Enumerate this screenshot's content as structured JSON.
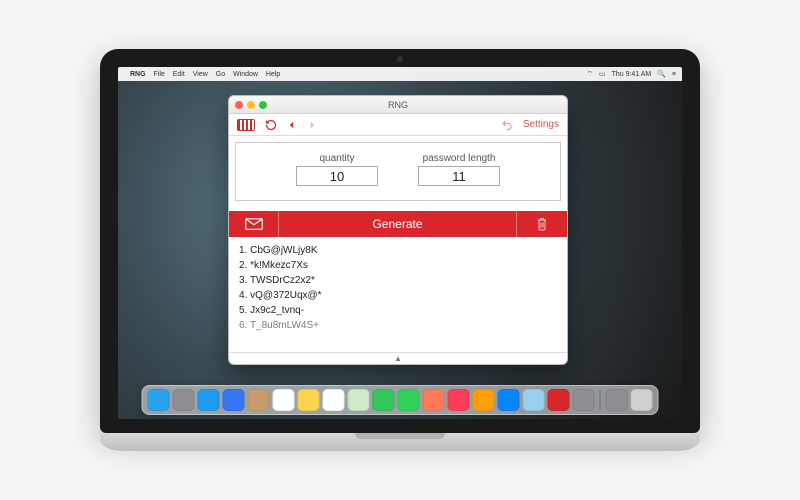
{
  "menubar": {
    "app": "RNG",
    "items": [
      "File",
      "Edit",
      "View",
      "Go",
      "Window",
      "Help"
    ],
    "clock": "Thu 9:41 AM"
  },
  "window": {
    "title": "RNG"
  },
  "toolbar": {
    "refresh_icon": "refresh-icon",
    "back_icon": "back-icon",
    "forward_icon": "forward-icon",
    "undo_icon": "undo-icon",
    "settings_label": "Settings"
  },
  "inputs": {
    "quantity": {
      "label": "quantity",
      "value": "10"
    },
    "length": {
      "label": "password length",
      "value": "11"
    }
  },
  "actions": {
    "mail_icon": "mail-icon",
    "generate_label": "Generate",
    "trash_icon": "trash-icon"
  },
  "results": [
    "CbG@jWLjy8K",
    "*k!Mkezc7Xs",
    "TWSDrCz2x2*",
    "vQ@372Uqx@*",
    "Jx9c2_tvnq-",
    "T_8u8mLW4S+"
  ],
  "dock": {
    "apps": [
      {
        "name": "finder",
        "color": "#2aa3ef"
      },
      {
        "name": "launchpad",
        "color": "#8e8e93"
      },
      {
        "name": "safari",
        "color": "#1e9bf0"
      },
      {
        "name": "mail",
        "color": "#3478f6"
      },
      {
        "name": "contacts",
        "color": "#c69c6d"
      },
      {
        "name": "calendar",
        "color": "#ffffff"
      },
      {
        "name": "notes",
        "color": "#ffd34e"
      },
      {
        "name": "reminders",
        "color": "#ffffff"
      },
      {
        "name": "maps",
        "color": "#cfe8c6"
      },
      {
        "name": "messages",
        "color": "#34c759"
      },
      {
        "name": "facetime",
        "color": "#30d158"
      },
      {
        "name": "photobooth",
        "color": "#ff7a59"
      },
      {
        "name": "itunes",
        "color": "#fc3d59"
      },
      {
        "name": "ibooks",
        "color": "#ff9f0a"
      },
      {
        "name": "appstore",
        "color": "#0a84ff"
      },
      {
        "name": "preview",
        "color": "#9ad0ec"
      },
      {
        "name": "rng",
        "color": "#d9262d"
      },
      {
        "name": "settings",
        "color": "#8e8e93"
      }
    ],
    "tray": [
      {
        "name": "downloads",
        "color": "#8e8e93"
      },
      {
        "name": "trash",
        "color": "#d0d0d0"
      }
    ]
  }
}
